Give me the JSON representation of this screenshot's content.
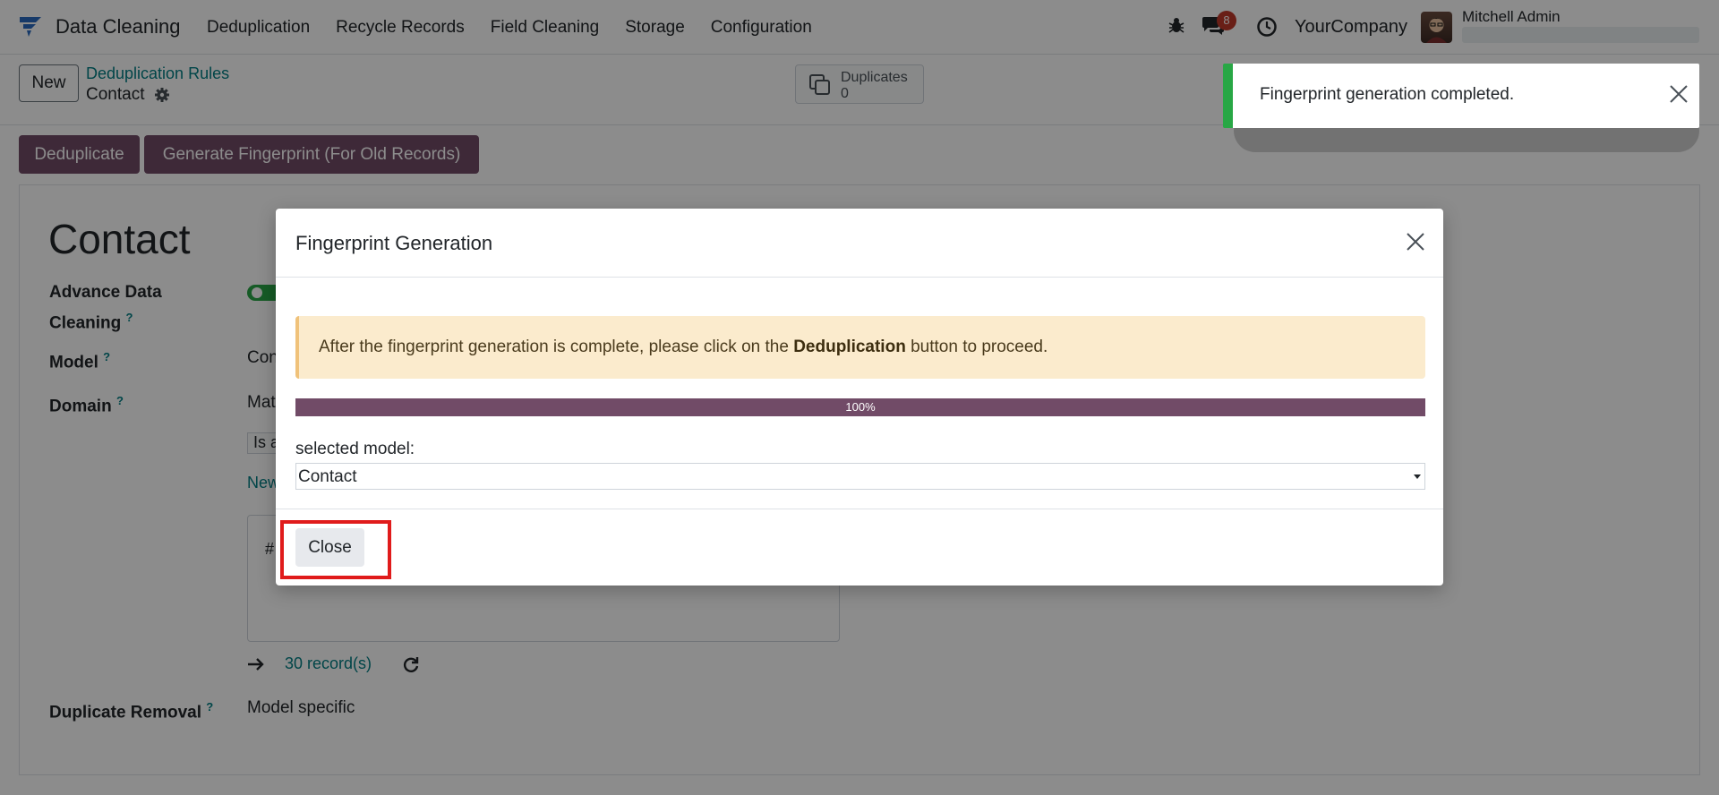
{
  "navbar": {
    "app_name": "Data Cleaning",
    "menu": [
      "Deduplication",
      "Recycle Records",
      "Field Cleaning",
      "Storage",
      "Configuration"
    ],
    "chat_badge": "8",
    "company": "YourCompany",
    "user_name": "Mitchell Admin"
  },
  "control_panel": {
    "new_label": "New",
    "breadcrumb_parent": "Deduplication Rules",
    "breadcrumb_current": "Contact",
    "duplicates_label": "Duplicates",
    "duplicates_count": "0",
    "dedup_button": "Deduplicate",
    "fingerprint_button": "Generate Fingerprint (For Old Records)"
  },
  "form": {
    "title": "Contact",
    "advance_label_line1": "Advance Data",
    "advance_label_line2": "Cleaning",
    "model_label": "Model",
    "model_value": "Con",
    "domain_label": "Domain",
    "domain_value": "Mat",
    "domain_chip": "Is a",
    "new_rule": "New",
    "code_hash": "#",
    "records_link": "30 record(s)",
    "dup_removal_label": "Duplicate Removal",
    "dup_removal_value": "Model specific",
    "help_mark": "?"
  },
  "toast": {
    "message": "Fingerprint generation completed.",
    "accent": "#28a745"
  },
  "modal": {
    "title": "Fingerprint Generation",
    "alert_before": "After the fingerprint generation is complete, please click on the ",
    "alert_bold": "Deduplication",
    "alert_after": " button to proceed.",
    "progress": 1.0,
    "progress_text": "100%",
    "model_label": "selected model:",
    "model_value": "Contact",
    "close_label": "Close"
  },
  "colors": {
    "brand": "#714b67",
    "link": "#017e84",
    "highlight": "#e01b1b"
  }
}
